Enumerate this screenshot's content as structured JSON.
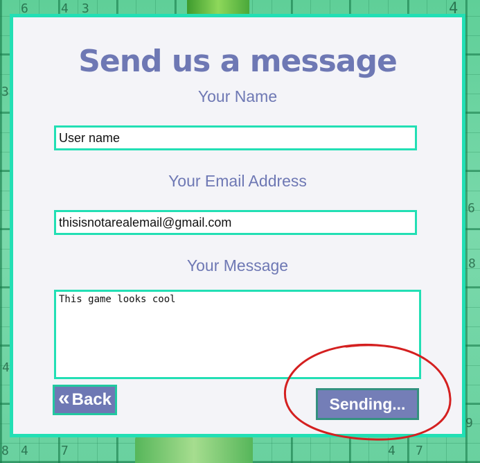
{
  "form": {
    "title": "Send us a message",
    "name_label": "Your Name",
    "name_value": "User name",
    "email_label": "Your Email Address",
    "email_value": "thisisnotarealemail@gmail.com",
    "message_label": "Your Message",
    "message_value": "This game looks cool",
    "back_icon": "«",
    "back_label": "Back",
    "send_label": "Sending..."
  },
  "background": {
    "digits": [
      "6",
      "4",
      "3",
      "4",
      "3",
      "6",
      "8",
      "8",
      "4",
      "7",
      "4",
      "7",
      "4",
      "9"
    ]
  },
  "colors": {
    "accent": "#22dfb4",
    "primary": "#6e78b4",
    "card_bg": "#f4f4f8",
    "annotation": "#d42020"
  },
  "icons": {
    "back": "double-chevron-left-icon"
  }
}
